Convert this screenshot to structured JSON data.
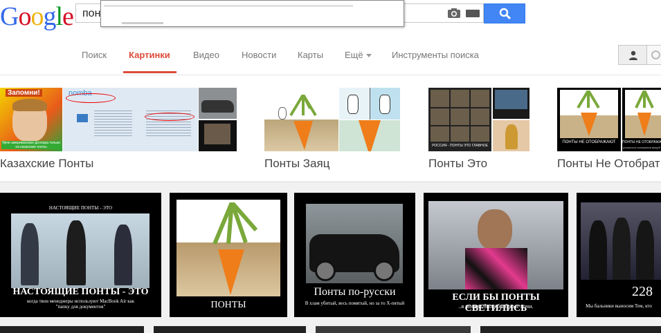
{
  "header": {
    "logo": {
      "letters": [
        "G",
        "o",
        "o",
        "g",
        "l",
        "e"
      ],
      "colors": [
        "#3369e8",
        "#d50f25",
        "#eeb211",
        "#3369e8",
        "#009925",
        "#d50f25"
      ]
    },
    "search": {
      "query": "понт"
    }
  },
  "tabs": [
    {
      "label": "Поиск",
      "active": false
    },
    {
      "label": "Картинки",
      "active": true
    },
    {
      "label": "Видео",
      "active": false
    },
    {
      "label": "Новости",
      "active": false
    },
    {
      "label": "Карты",
      "active": false
    },
    {
      "label": "Ещё",
      "active": false
    },
    {
      "label": "Инструменты поиска",
      "active": false
    }
  ],
  "related": [
    {
      "title": "Казахские Понты",
      "thumb_texts": [
        "Запомни!",
        "Ярче американские доллара только на казахские понты"
      ]
    },
    {
      "title": "Понты Заяц"
    },
    {
      "title": "Понты Это",
      "thumb_texts": [
        "РОССИЯ - ПОНТЫ ЭТО ГЛАВНОЕ"
      ]
    },
    {
      "title": "Понты Не Отобрат",
      "thumb_texts": [
        "ПОНТЫ НЕ ОТОБРАЖАЮТ",
        "реального положения вещей"
      ]
    }
  ],
  "results": [
    {
      "top": "НАСТОЯЩИЕ ПОНТЫ - ЭТО",
      "title": "НАСТОЯЩИЕ ПОНТЫ - ЭТО",
      "sub": "когда твои менеджеры используют MacBook Air как \"папку для документов\""
    },
    {
      "title": "ПОНТЫ"
    },
    {
      "title": "Понты по-русски",
      "sub": "В хлам убитый, весь помятый, но за то X-пятый"
    },
    {
      "title": "ЕСЛИ БЫ ПОНТЫ СВЕТИЛИСЬ",
      "sub": "..в москве были бы белые ночи."
    },
    {
      "title": "228",
      "sub": "Мы бальники выносим Тем, кто"
    }
  ],
  "colors": {
    "accent": "#dd4b39",
    "search_button": "#4285f4"
  }
}
